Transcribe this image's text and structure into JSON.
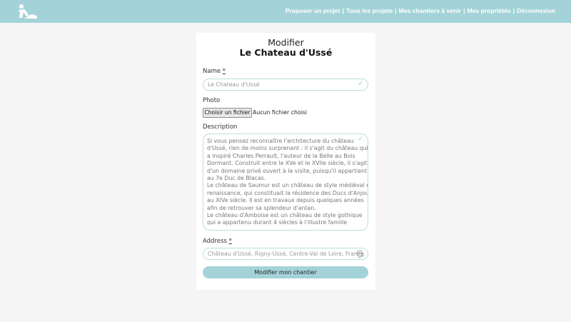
{
  "nav": {
    "logo_icon": "worker-shovel-icon",
    "links": [
      "Proposer un projet",
      "Tous les projets",
      "Mes chantiers à venir",
      "Mes propriétés",
      "Déconnexion"
    ],
    "separator": "|"
  },
  "form": {
    "heading": "Modifier",
    "title": "Le Chateau d'Ussé",
    "name": {
      "label": "Name",
      "required": "*",
      "value": "Le Chateau d'Ussé",
      "icon": "check-icon"
    },
    "photo": {
      "label": "Photo",
      "button": "Choisir un fichier",
      "status": "Aucun fichier choisi"
    },
    "description": {
      "label": "Description",
      "icon": "check-icon",
      "lines": [
        "Si vous pensez reconnaître l'architecture du château",
        "d'Ussé, rien de moins surprenant : il s'agit du château qui",
        "a inspiré Charles Perrault, l'auteur de la Belle au Bois",
        "Dormant. Construit entre le XVe et le XVIIe siècle, il s'agit",
        "d'un domaine privé ouvert à la visite, puisqu'il appartient",
        "au 7e Duc de Blacas.",
        "Le château de Saumur est un château de style médiéval et",
        "renaissance, qui constituait la résidence des Ducs d'Anjou",
        "au XIVe siècle. Il est en travaux depuis quelques années",
        "afin de retrouver sa splendeur d'antan.",
        "Le château d'Amboise est un château de style gothique",
        "qui a appartenu durant 4 siècles à l'illustre famille"
      ]
    },
    "address": {
      "label": "Address",
      "required": "*",
      "value": "Château d'Ussé, Rigny-Ussé, Centre-Val de Loire, France",
      "icon": "location-pin-check-icon"
    },
    "submit": "Modifier mon chantier"
  },
  "colors": {
    "accent": "#a3d3d8",
    "field_border": "#b9e0dd",
    "background": "#f5f5f5"
  }
}
